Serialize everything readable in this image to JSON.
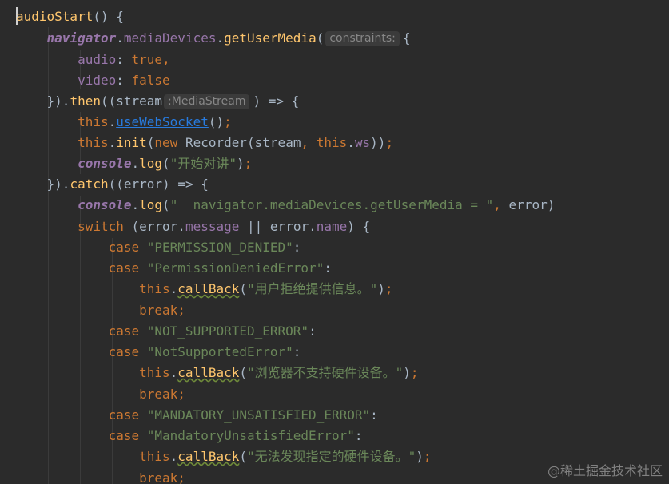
{
  "code": {
    "method_name": "audioStart",
    "l1_rest": "() {",
    "navigator": "navigator",
    "media_devices": "mediaDevices",
    "get_user_media": "getUserMedia",
    "hint_constraints": "constraints:",
    "audio_key": "audio",
    "true_val": "true",
    "video_key": "video",
    "false_val": "false",
    "then": "then",
    "stream": "stream",
    "hint_mediastream": ":MediaStream",
    "arrow_open": ") => {",
    "this_kw": "this",
    "use_web_socket": "useWebSocket",
    "init": "init",
    "new_kw": "new",
    "recorder": "Recorder",
    "ws": "ws",
    "console": "console",
    "log": "log",
    "str_start_talk": "\"开始对讲\"",
    "catch": "catch",
    "error": "error",
    "str_navigator_msg": "\"  navigator.mediaDevices.getUserMedia = \"",
    "switch_kw": "switch",
    "message": "message",
    "or_op": "||",
    "name_prop": "name",
    "case_kw": "case",
    "str_permission_denied": "\"PERMISSION_DENIED\"",
    "str_permission_denied_error": "\"PermissionDeniedError\"",
    "callback": "callBack",
    "str_user_refused": "\"用户拒绝提供信息。\"",
    "break_kw": "break",
    "str_not_supported_error": "\"NOT_SUPPORTED_ERROR\"",
    "str_notsupported_error": "\"NotSupportedError\"",
    "str_browser_no_support": "\"浏览器不支持硬件设备。\"",
    "str_mandatory_unsatisfied_error": "\"MANDATORY_UNSATISFIED_ERROR\"",
    "str_mandatoryunsatisfied_error": "\"MandatoryUnsatisfiedError\"",
    "str_cannot_find_device": "\"无法发现指定的硬件设备。\""
  },
  "watermark": "@稀土掘金技术社区",
  "colors": {
    "background": "#2b2b2b",
    "keyword": "#cc7832",
    "function": "#ffc66d",
    "property": "#9876aa",
    "string": "#6a8759",
    "text": "#a9b7c6",
    "link": "#287bde"
  }
}
